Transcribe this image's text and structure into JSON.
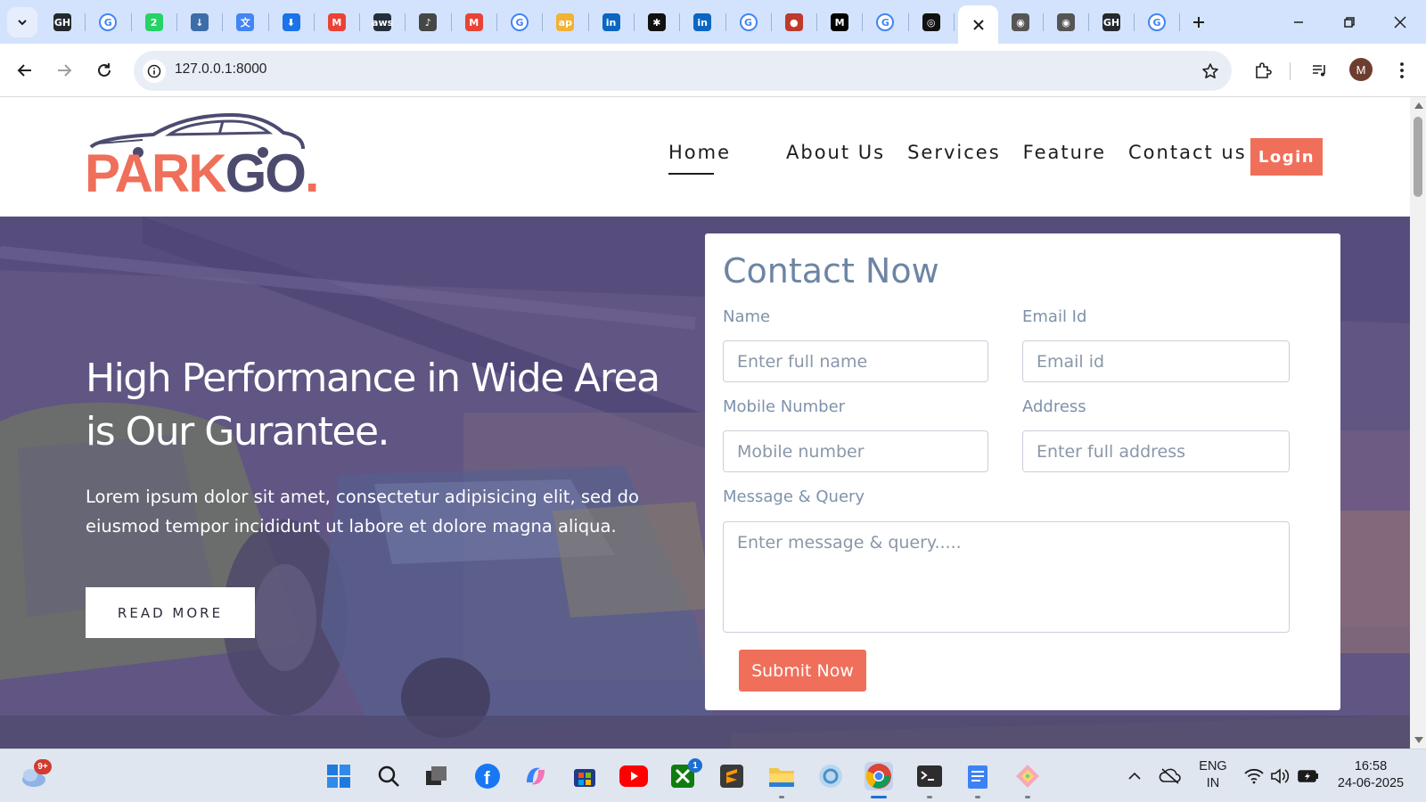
{
  "browser": {
    "tabs": [
      {
        "icon": "github-icon",
        "color": "#24292f"
      },
      {
        "icon": "google-icon",
        "color": "#4285f4"
      },
      {
        "icon": "whatsapp-2-icon",
        "color": "#25d366"
      },
      {
        "icon": "download-page-icon",
        "color": "#3b6ea8"
      },
      {
        "icon": "google-translate-icon",
        "color": "#4285f4"
      },
      {
        "icon": "download-icon",
        "color": "#1a73e8"
      },
      {
        "icon": "gmail-icon",
        "color": "#ea4335"
      },
      {
        "icon": "aws-icon",
        "color": "#232f3e"
      },
      {
        "icon": "audio-icon",
        "color": "#444746"
      },
      {
        "icon": "gmail-icon",
        "color": "#ea4335"
      },
      {
        "icon": "google-icon",
        "color": "#4285f4"
      },
      {
        "icon": "apna-icon",
        "color": "#f2b233"
      },
      {
        "icon": "linkedin-icon",
        "color": "#0a66c2"
      },
      {
        "icon": "asterisk-icon",
        "color": "#111111"
      },
      {
        "icon": "linkedin-icon",
        "color": "#0a66c2"
      },
      {
        "icon": "google-icon",
        "color": "#4285f4"
      },
      {
        "icon": "red-dots-icon",
        "color": "#c0392b"
      },
      {
        "icon": "medium-icon",
        "color": "#000000"
      },
      {
        "icon": "google-icon",
        "color": "#4285f4"
      },
      {
        "icon": "openai-icon",
        "color": "#111111"
      }
    ],
    "tabs_after_active": [
      {
        "icon": "chrome-gray-icon",
        "color": "#555555"
      },
      {
        "icon": "chrome-gray-icon",
        "color": "#555555"
      },
      {
        "icon": "github-icon",
        "color": "#24292f"
      },
      {
        "icon": "google-icon",
        "color": "#4285f4"
      }
    ],
    "url": "127.0.0.1:8000",
    "profile_initial": "M"
  },
  "site": {
    "logo": {
      "part1": "PARK",
      "part2": "GO",
      "dot": "."
    },
    "nav": {
      "home": "Home",
      "about": "About Us",
      "services": "Services",
      "feature": "Feature",
      "contact": "Contact us",
      "login": "Login"
    },
    "hero": {
      "title": "High Performance in Wide Area is Our Gurantee.",
      "text": "Lorem ipsum dolor sit amet, consectetur adipisicing elit, sed do eiusmod tempor incididunt ut labore et dolore magna aliqua.",
      "read_more": "READ MORE"
    },
    "contact": {
      "title": "Contact Now",
      "name_label": "Name",
      "name_placeholder": "Enter full name",
      "email_label": "Email Id",
      "email_placeholder": "Email id",
      "mobile_label": "Mobile Number",
      "mobile_placeholder": "Mobile number",
      "address_label": "Address",
      "address_placeholder": "Enter full address",
      "message_label": "Message & Query",
      "message_placeholder": "Enter message & query.....",
      "submit": "Submit Now"
    },
    "colors": {
      "accent": "#ef6f5a",
      "logo_dark": "#4c4b6f",
      "form_text": "#6d85a3"
    }
  },
  "taskbar": {
    "weather_badge": "9+",
    "xbox_badge": "1",
    "lang_line1": "ENG",
    "lang_line2": "IN",
    "time": "16:58",
    "date": "24-06-2025"
  }
}
